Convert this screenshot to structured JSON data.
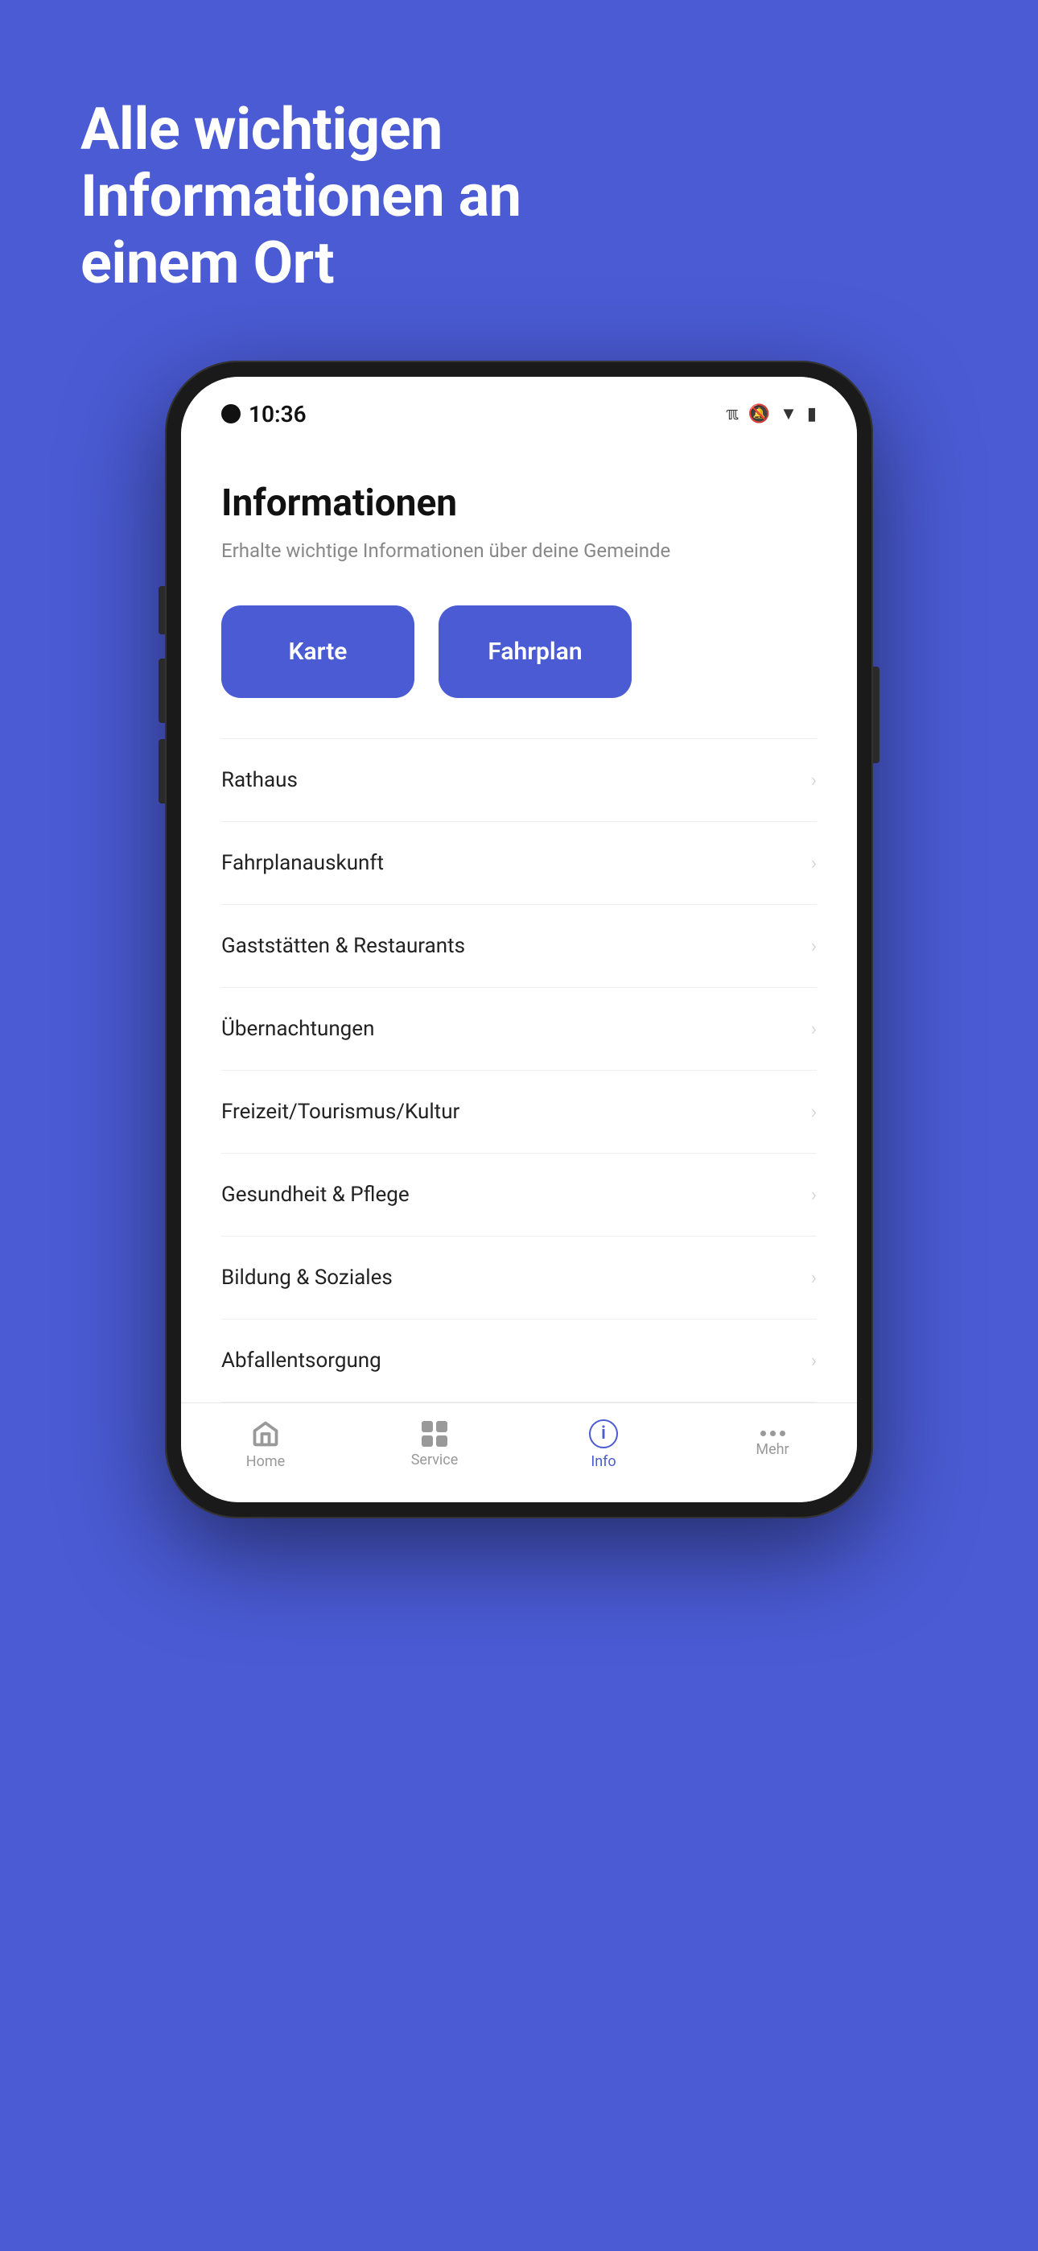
{
  "background_color": "#4A5BD4",
  "hero": {
    "title": "Alle wichtigen Informationen an einem Ort"
  },
  "status_bar": {
    "time": "10:36",
    "icons": [
      "bluetooth",
      "bell-off",
      "wifi",
      "battery"
    ]
  },
  "app": {
    "page_title": "Informationen",
    "page_subtitle": "Erhalte wichtige Informationen über deine Gemeinde",
    "quick_buttons": [
      {
        "id": "karte",
        "label": "Karte"
      },
      {
        "id": "fahrplan",
        "label": "Fahrplan"
      }
    ],
    "list_items": [
      {
        "id": "rathaus",
        "label": "Rathaus"
      },
      {
        "id": "fahrplanauskunft",
        "label": "Fahrplanauskunft"
      },
      {
        "id": "gaststaetten",
        "label": "Gaststätten & Restaurants"
      },
      {
        "id": "uebernachtungen",
        "label": "Übernachtungen"
      },
      {
        "id": "freizeit",
        "label": "Freizeit/Tourismus/Kultur"
      },
      {
        "id": "gesundheit",
        "label": "Gesundheit & Pflege"
      },
      {
        "id": "bildung",
        "label": "Bildung & Soziales"
      },
      {
        "id": "abfallentsorgung",
        "label": "Abfallentsorgung"
      }
    ]
  },
  "bottom_nav": {
    "items": [
      {
        "id": "home",
        "label": "Home",
        "active": false
      },
      {
        "id": "service",
        "label": "Service",
        "active": false
      },
      {
        "id": "info",
        "label": "Info",
        "active": true
      },
      {
        "id": "mehr",
        "label": "Mehr",
        "active": false
      }
    ]
  }
}
